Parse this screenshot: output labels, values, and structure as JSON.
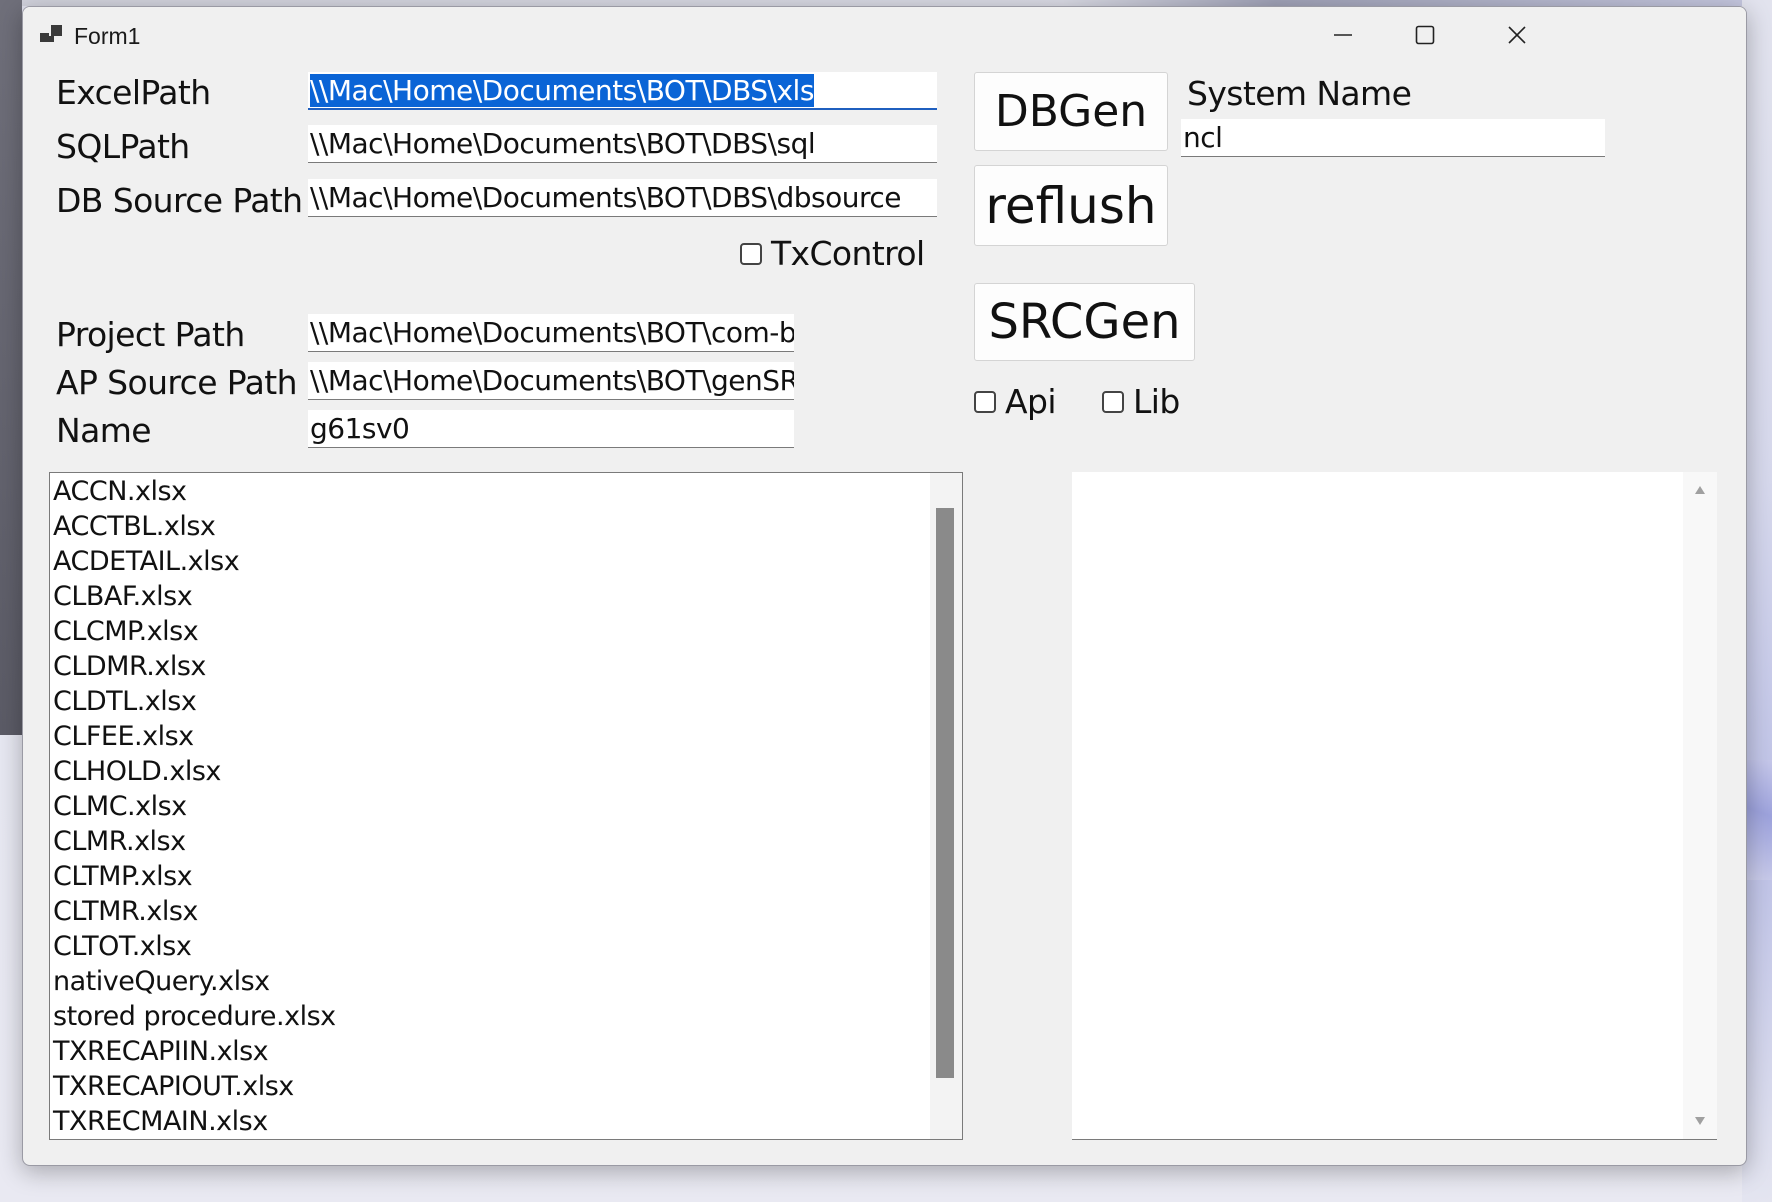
{
  "window": {
    "title": "Form1",
    "minimize_icon": "minimize-icon",
    "maximize_icon": "maximize-icon",
    "close_icon": "close-icon"
  },
  "fields": {
    "excel_path": {
      "label": "ExcelPath",
      "value": "\\\\Mac\\Home\\Documents\\BOT\\DBS\\xls"
    },
    "sql_path": {
      "label": "SQLPath",
      "value": "\\\\Mac\\Home\\Documents\\BOT\\DBS\\sql"
    },
    "db_source_path": {
      "label": "DB Source Path",
      "value": "\\\\Mac\\Home\\Documents\\BOT\\DBS\\dbsource"
    },
    "project_path": {
      "label": "Project Path",
      "value": "\\\\Mac\\Home\\Documents\\BOT\\com-b"
    },
    "ap_source_path": {
      "label": "AP Source Path",
      "value": "\\\\Mac\\Home\\Documents\\BOT\\genSR("
    },
    "name": {
      "label": "Name",
      "value": "g61sv0"
    },
    "system_name": {
      "label": "System Name",
      "value": "ncl"
    }
  },
  "checkboxes": {
    "txcontrol": {
      "label": "TxControl",
      "checked": false
    },
    "api": {
      "label": "Api",
      "checked": false
    },
    "lib": {
      "label": "Lib",
      "checked": false
    }
  },
  "buttons": {
    "dbgen": "DBGen",
    "reflush": "reflush",
    "srcgen": "SRCGen"
  },
  "file_list": {
    "items": [
      "ACCN.xlsx",
      "ACCTBL.xlsx",
      "ACDETAIL.xlsx",
      "CLBAF.xlsx",
      "CLCMP.xlsx",
      "CLDMR.xlsx",
      "CLDTL.xlsx",
      "CLFEE.xlsx",
      "CLHOLD.xlsx",
      "CLMC.xlsx",
      "CLMR.xlsx",
      "CLTMP.xlsx",
      "CLTMR.xlsx",
      "CLTOT.xlsx",
      "nativeQuery.xlsx",
      "stored procedure.xlsx",
      "TXRECAPIIN.xlsx",
      "TXRECAPIOUT.xlsx",
      "TXRECMAIN.xlsx"
    ]
  },
  "output": {
    "text": ""
  },
  "colors": {
    "selection": "#0a64d6",
    "window_bg": "#f0f0f0",
    "scroll_thumb": "#8a8a8a"
  }
}
